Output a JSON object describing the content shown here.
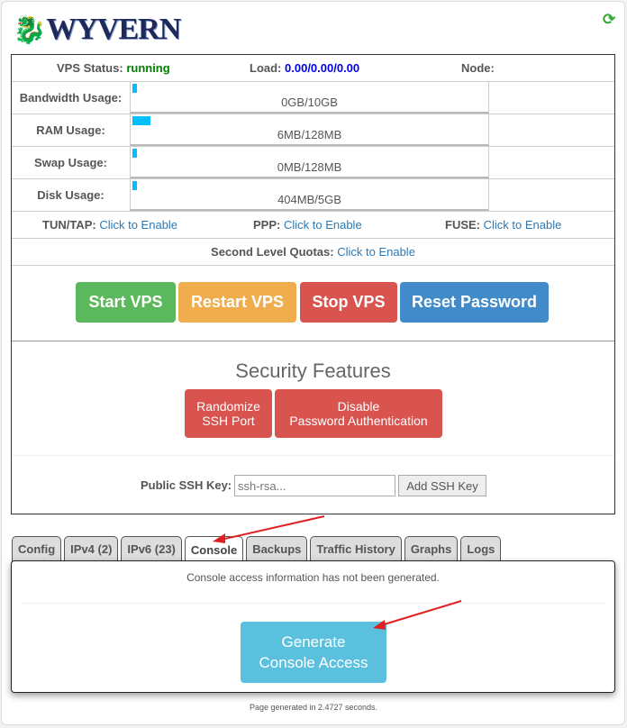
{
  "logo": {
    "text": "WYVERN"
  },
  "header": {
    "refresh_icon": "refresh-icon"
  },
  "status": {
    "vps_label": "VPS Status:",
    "vps_value": "running",
    "load_label": "Load:",
    "load_value": "0.00/0.00/0.00",
    "node_label": "Node:",
    "colors": {
      "running": "#008000",
      "load": "#0000ee"
    }
  },
  "usage": [
    {
      "label": "Bandwidth Usage:",
      "value": "0GB/10GB",
      "fill_percent": 1
    },
    {
      "label": "RAM Usage:",
      "value": "6MB/128MB",
      "fill_percent": 5
    },
    {
      "label": "Swap Usage:",
      "value": "0MB/128MB",
      "fill_percent": 1
    },
    {
      "label": "Disk Usage:",
      "value": "404MB/5GB",
      "fill_percent": 1
    }
  ],
  "features": {
    "tuntap_label": "TUN/TAP:",
    "tuntap_link": "Click to Enable",
    "ppp_label": "PPP:",
    "ppp_link": "Click to Enable",
    "fuse_label": "FUSE:",
    "fuse_link": "Click to Enable",
    "quotas_label": "Second Level Quotas:",
    "quotas_link": "Click to Enable"
  },
  "actions": {
    "start": "Start VPS",
    "restart": "Restart VPS",
    "stop": "Stop VPS",
    "reset": "Reset Password"
  },
  "security": {
    "title": "Security Features",
    "randomize_line1": "Randomize",
    "randomize_line2": "SSH Port",
    "disable_line1": "Disable",
    "disable_line2": "Password Authentication"
  },
  "ssh": {
    "label": "Public SSH Key:",
    "placeholder": "ssh-rsa...",
    "button": "Add SSH Key"
  },
  "tabs": [
    "Config",
    "IPv4 (2)",
    "IPv6 (23)",
    "Console",
    "Backups",
    "Traffic History",
    "Graphs",
    "Logs"
  ],
  "active_tab": "Console",
  "console": {
    "message": "Console access information has not been generated.",
    "button_line1": "Generate",
    "button_line2": "Console Access"
  },
  "footer": "Page generated in 2.4727 seconds."
}
